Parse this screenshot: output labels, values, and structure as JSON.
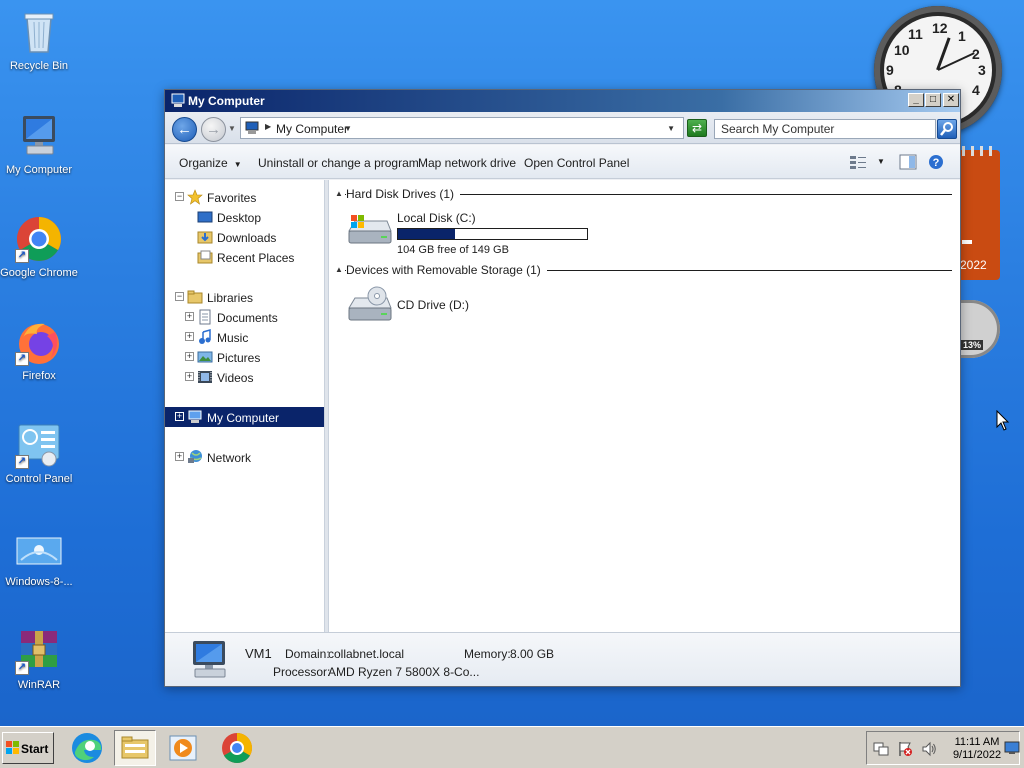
{
  "desktop": {
    "icons": [
      {
        "label": "Recycle Bin"
      },
      {
        "label": "My Computer"
      },
      {
        "label": "Google Chrome"
      },
      {
        "label": "Firefox"
      },
      {
        "label": "Control Panel"
      },
      {
        "label": "Windows-8-..."
      },
      {
        "label": "WinRAR"
      }
    ],
    "gadgets": {
      "calendar_year": "2022",
      "cpu_meter_percent": "13%"
    }
  },
  "window": {
    "title": "My Computer",
    "controls": {
      "minimize": "_",
      "maximize": "□",
      "close": "✕"
    },
    "address": {
      "location": "My Computer"
    },
    "search": {
      "placeholder": "Search My Computer"
    },
    "toolbar": {
      "organize": "Organize",
      "uninstall": "Uninstall or change a program",
      "map_drive": "Map network drive",
      "control_panel": "Open Control Panel"
    },
    "nav": {
      "favorites": "Favorites",
      "desktop": "Desktop",
      "downloads": "Downloads",
      "recent": "Recent Places",
      "libraries": "Libraries",
      "documents": "Documents",
      "music": "Music",
      "pictures": "Pictures",
      "videos": "Videos",
      "my_computer": "My Computer",
      "network": "Network"
    },
    "groups": {
      "hdd": {
        "header": "Hard Disk Drives (1)",
        "drives": [
          {
            "name": "Local Disk (C:)",
            "free_text": "104 GB free of 149 GB",
            "used_fraction": 0.302
          }
        ]
      },
      "removable": {
        "header": "Devices with Removable Storage (1)",
        "drives": [
          {
            "name": "CD Drive (D:)"
          }
        ]
      }
    },
    "details": {
      "name": "VM1",
      "domain_label": "Domain:",
      "domain_value": "collabnet.local",
      "memory_label": "Memory:",
      "memory_value": "8.00 GB",
      "processor_label": "Processor:",
      "processor_value": "AMD Ryzen 7 5800X 8-Co..."
    }
  },
  "taskbar": {
    "start_label": "Start",
    "clock_time": "11:11 AM",
    "clock_date": "9/11/2022"
  },
  "colors": {
    "desktop_bg": "#2b7fe1",
    "selection": "#0a246a",
    "titlebar": "#0a246a"
  }
}
